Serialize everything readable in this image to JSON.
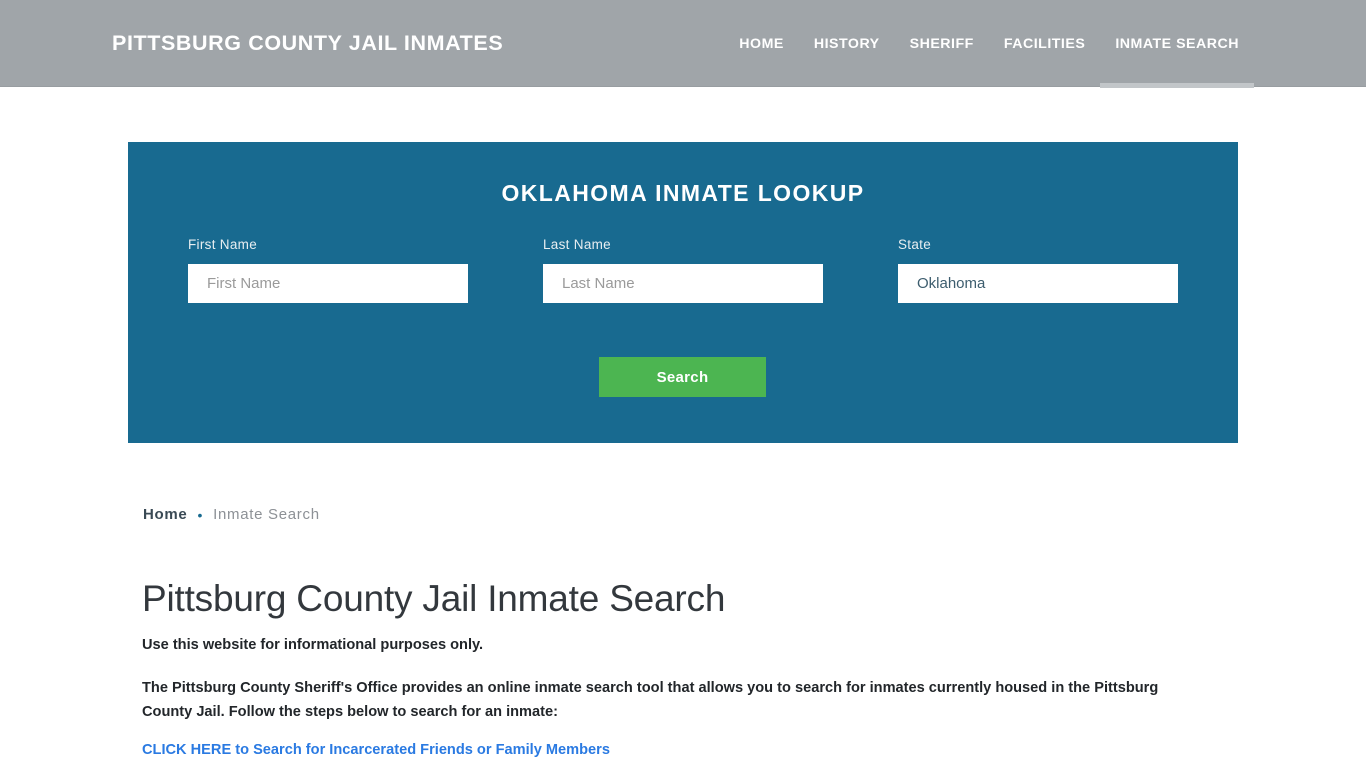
{
  "header": {
    "brand": "PITTSBURG COUNTY JAIL INMATES",
    "nav": [
      {
        "label": "HOME",
        "active": false
      },
      {
        "label": "HISTORY",
        "active": false
      },
      {
        "label": "SHERIFF",
        "active": false
      },
      {
        "label": "FACILITIES",
        "active": false
      },
      {
        "label": "INMATE SEARCH",
        "active": true
      }
    ]
  },
  "lookup": {
    "title": "OKLAHOMA INMATE LOOKUP",
    "fields": {
      "first_name": {
        "label": "First Name",
        "value": "",
        "placeholder": "First Name"
      },
      "last_name": {
        "label": "Last Name",
        "value": "",
        "placeholder": "Last Name"
      },
      "state": {
        "label": "State",
        "value": "Oklahoma",
        "placeholder": "State"
      }
    },
    "search_label": "Search",
    "panel_color": "#186a90",
    "button_color": "#4cb551"
  },
  "breadcrumb": {
    "home": "Home",
    "separator": "•",
    "current": "Inmate Search"
  },
  "content": {
    "title": "Pittsburg County Jail Inmate Search",
    "lead": "Use this website for informational purposes only.",
    "paragraph": "The Pittsburg County Sheriff's Office provides an online inmate search tool that allows you to search for inmates currently housed in the Pittsburg County Jail. Follow the steps below to search for an inmate:",
    "cta_link": "CLICK HERE to Search for Incarcerated Friends or Family Members",
    "link_color": "#2a7ae2"
  }
}
